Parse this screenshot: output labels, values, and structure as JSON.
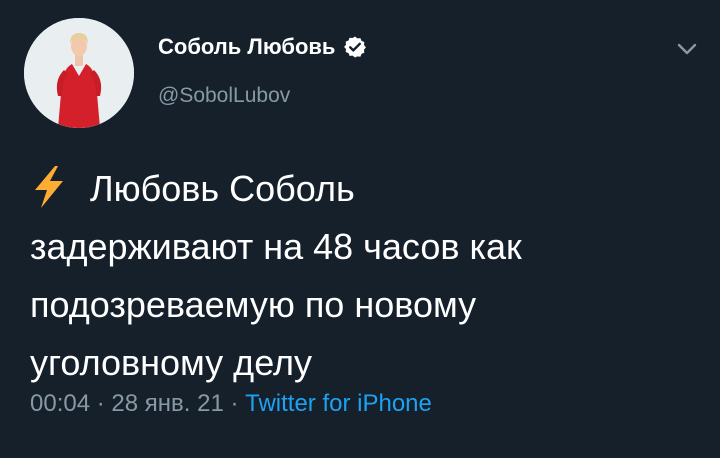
{
  "author": {
    "display_name": "Соболь Любовь",
    "handle": "@SobolLubov",
    "verified": true,
    "avatar_icon": "profile-photo-red-dress"
  },
  "menu": {
    "icon": "chevron-down-icon"
  },
  "tweet": {
    "emoji": "high-voltage-icon",
    "lines": [
      "Любовь Соболь",
      "задерживают на 48 часов как",
      "подозреваемую по новому",
      "уголовному делу"
    ]
  },
  "meta": {
    "time": "00:04",
    "sep1": " · ",
    "date": "28 янв. 21",
    "sep2": " · ",
    "source": "Twitter for iPhone"
  },
  "colors": {
    "background": "#15202b",
    "text": "#ffffff",
    "secondary": "#8899a6",
    "accent": "#1da1f2"
  }
}
